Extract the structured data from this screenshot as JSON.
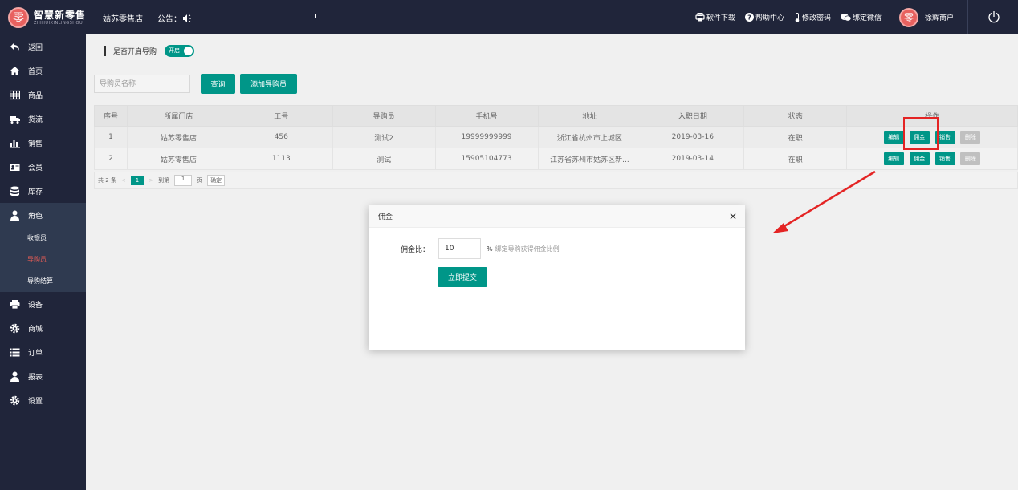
{
  "topbar": {
    "logo_title": "智慧新零售",
    "logo_sub": "ZHIHUIXINLINGSHOU",
    "logo_char": "零",
    "store_name": "姑苏零售店",
    "notice_label": "公告：",
    "links": [
      {
        "label": "软件下载",
        "icon": "printer-icon"
      },
      {
        "label": "帮助中心",
        "icon": "help-icon"
      },
      {
        "label": "修改密码",
        "icon": "thermometer-icon"
      },
      {
        "label": "绑定微信",
        "icon": "wechat-icon"
      }
    ],
    "user_name": "徐辉商户",
    "user_char": "零"
  },
  "sidebar": {
    "items": [
      {
        "label": "返回",
        "icon": "back-icon"
      },
      {
        "label": "首页",
        "icon": "home-icon"
      },
      {
        "label": "商品",
        "icon": "grid-icon"
      },
      {
        "label": "货流",
        "icon": "truck-icon"
      },
      {
        "label": "销售",
        "icon": "bar-chart-icon"
      },
      {
        "label": "会员",
        "icon": "id-card-icon"
      },
      {
        "label": "库存",
        "icon": "database-icon"
      },
      {
        "label": "角色",
        "icon": "user-icon"
      },
      {
        "label": "设备",
        "icon": "printer-icon"
      },
      {
        "label": "商城",
        "icon": "gear-icon"
      },
      {
        "label": "订单",
        "icon": "list-icon"
      },
      {
        "label": "报表",
        "icon": "user-icon"
      },
      {
        "label": "设置",
        "icon": "gear-icon"
      }
    ],
    "sub_items": [
      {
        "label": "收银员"
      },
      {
        "label": "导购员"
      },
      {
        "label": "导购结算"
      }
    ]
  },
  "main": {
    "toggle_label": "是否开启导购",
    "toggle_text": "开启",
    "search_placeholder": "导购员名称",
    "query_label": "查询",
    "add_label": "添加导购员",
    "table": {
      "headers": [
        "序号",
        "所属门店",
        "工号",
        "导购员",
        "手机号",
        "地址",
        "入职日期",
        "状态",
        "操作"
      ],
      "rows": [
        [
          "1",
          "姑苏零售店",
          "456",
          "测试2",
          "19999999999",
          "浙江省杭州市上城区",
          "2019-03-16",
          "在职"
        ],
        [
          "2",
          "姑苏零售店",
          "1113",
          "测试",
          "15905104773",
          "江苏省苏州市姑苏区新...",
          "2019-03-14",
          "在职"
        ]
      ],
      "actions": [
        "编辑",
        "佣金",
        "销售",
        "删除"
      ]
    },
    "pager": {
      "total": "共 2 条",
      "prev": "<",
      "current": "1",
      "next": ">",
      "goto": "到第",
      "goto_value": "1",
      "page_unit": "页",
      "confirm": "确定"
    }
  },
  "modal": {
    "title": "佣金",
    "close": "✕",
    "field_label": "佣金比：",
    "field_value": "10",
    "unit": "%",
    "hint": "绑定导购获得佣金比例",
    "submit_label": "立即提交"
  },
  "colors": {
    "primary": "#009688",
    "sidebar_bg": "#20253a",
    "active_sub": "#e05b55",
    "annotation_red": "#e42424"
  }
}
